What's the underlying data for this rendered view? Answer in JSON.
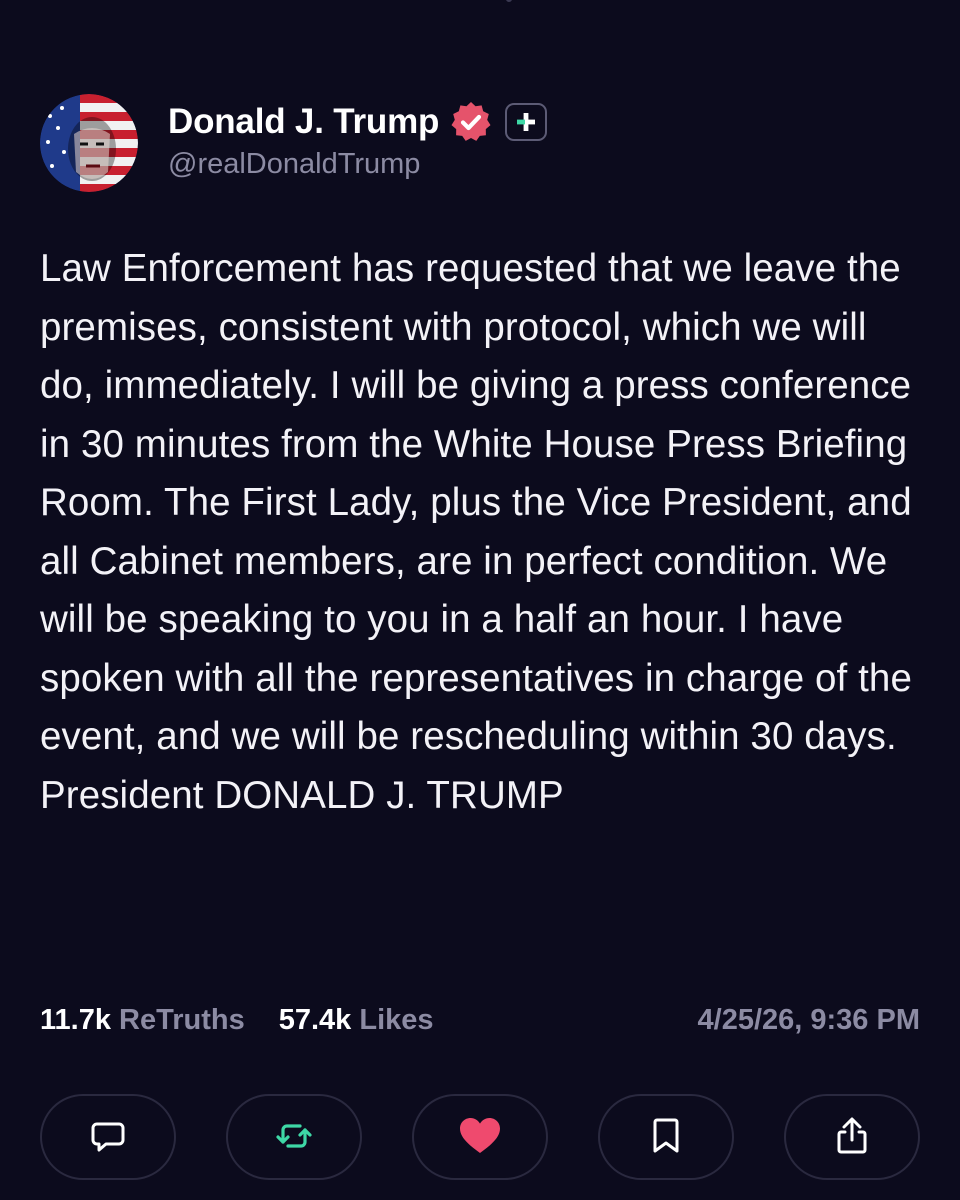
{
  "post": {
    "author": {
      "display_name": "Donald J. Trump",
      "handle": "@realDonaldTrump",
      "verified": true,
      "badge_icon": "verified-check-icon",
      "follow_icon": "plus-icon"
    },
    "text": "Law Enforcement has requested that we leave the premises, consistent with protocol, which we will do, immediately. I will be giving a press conference in 30 minutes from the White House Press Briefing Room. The First Lady, plus the Vice President, and all Cabinet members, are in perfect condition. We will be speaking to you in a half an hour. I have spoken with all the representatives in charge of the event, and we will be rescheduling within 30 days. President DONALD J. TRUMP",
    "stats": {
      "retruths_count": "11.7k",
      "retruths_label": "ReTruths",
      "likes_count": "57.4k",
      "likes_label": "Likes"
    },
    "timestamp": "4/25/26, 9:36 PM"
  },
  "actions": [
    {
      "name": "reply",
      "icon": "comment-icon"
    },
    {
      "name": "retruth",
      "icon": "repost-icon"
    },
    {
      "name": "like",
      "icon": "heart-icon"
    },
    {
      "name": "bookmark",
      "icon": "bookmark-icon"
    },
    {
      "name": "share",
      "icon": "share-icon"
    }
  ],
  "colors": {
    "background": "#0c0b1d",
    "text_primary": "#f3f2f7",
    "text_secondary": "#8c8ba3",
    "verified_badge": "#e5536b",
    "like_heart": "#ef4a6e",
    "retruth_green": "#3ed8a6",
    "button_border": "#2a293f"
  }
}
